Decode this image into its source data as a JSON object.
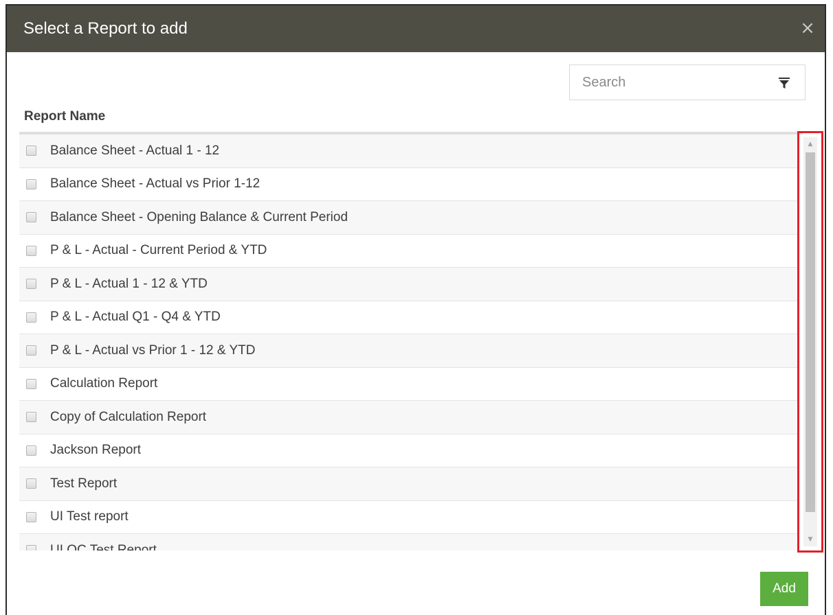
{
  "dialog": {
    "title": "Select a Report to add",
    "close_label": "×"
  },
  "search": {
    "placeholder": "Search",
    "value": ""
  },
  "table": {
    "column_header": "Report Name",
    "rows": [
      "Balance Sheet - Actual 1 - 12",
      "Balance Sheet - Actual vs Prior 1-12",
      "Balance Sheet - Opening Balance & Current Period",
      "P & L - Actual - Current Period & YTD",
      "P & L - Actual 1 - 12 & YTD",
      "P & L - Actual Q1 - Q4 & YTD",
      "P & L - Actual vs Prior 1 - 12 & YTD",
      "Calculation Report",
      "Copy of Calculation Report",
      "Jackson Report",
      "Test Report",
      "UI Test report",
      "UI QC Test Report"
    ]
  },
  "scrollbar": {
    "up_glyph": "▲",
    "down_glyph": "▼"
  },
  "footer": {
    "add_label": "Add"
  },
  "colors": {
    "header_bg": "#4f4e45",
    "add_button": "#5cae3e",
    "highlight": "#e0212a"
  },
  "icons": {
    "filter": "filter-icon",
    "close": "close-icon"
  }
}
